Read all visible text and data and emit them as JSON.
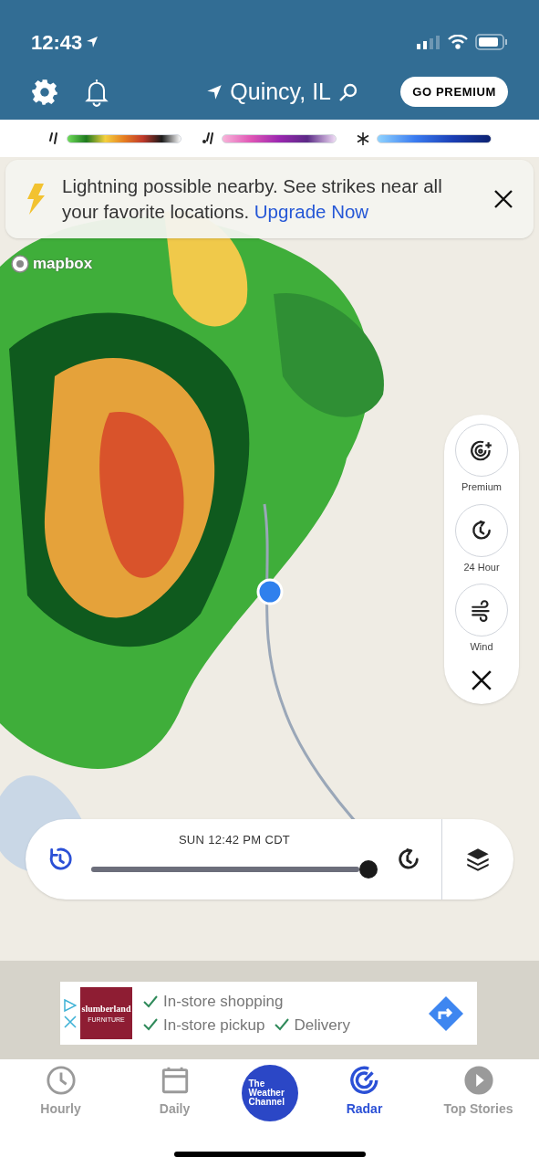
{
  "status_bar": {
    "time": "12:43"
  },
  "header": {
    "location": "Quincy, IL",
    "premium_button": "GO PREMIUM"
  },
  "legend": [
    {
      "kind": "rain"
    },
    {
      "kind": "mix"
    },
    {
      "kind": "snow"
    }
  ],
  "banner": {
    "text": "Lightning possible nearby. See strikes near all your favorite locations.",
    "link": "Upgrade Now"
  },
  "map": {
    "attribution": "mapbox"
  },
  "side_panel": [
    {
      "kind": "premium",
      "label": "Premium"
    },
    {
      "kind": "history",
      "label": "24 Hour"
    },
    {
      "kind": "wind",
      "label": "Wind"
    }
  ],
  "timeline": {
    "time": "SUN 12:42 PM CDT",
    "level": 1.0
  },
  "ad": {
    "brand": "slumberland",
    "brand_sub": "FURNITURE",
    "features": [
      "In-store shopping",
      "In-store pickup",
      "Delivery"
    ]
  },
  "tabs": [
    {
      "kind": "hourly",
      "label": "Hourly",
      "selected": false
    },
    {
      "kind": "daily",
      "label": "Daily",
      "selected": false
    },
    {
      "kind": "logo",
      "label": "The Weather Channel",
      "selected": false
    },
    {
      "kind": "radar",
      "label": "Radar",
      "selected": true
    },
    {
      "kind": "stories",
      "label": "Top Stories",
      "selected": false
    }
  ]
}
